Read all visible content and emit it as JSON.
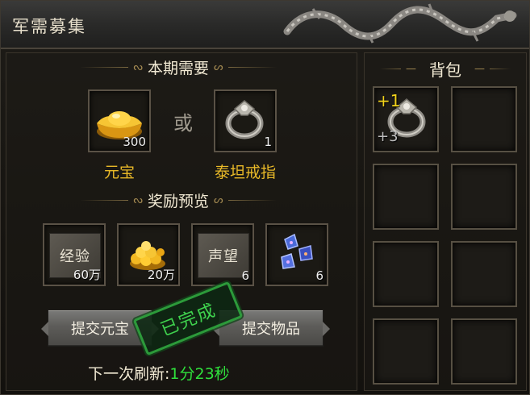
{
  "window": {
    "title": "军需募集"
  },
  "requirement": {
    "header": "本期需要",
    "or_label": "或",
    "items": [
      {
        "name": "元宝",
        "count": "300",
        "icon": "gold-ingot-icon"
      },
      {
        "name": "泰坦戒指",
        "count": "1",
        "icon": "ring-icon"
      }
    ]
  },
  "rewards": {
    "header": "奖励预览",
    "items": [
      {
        "label": "经验",
        "count": "60万",
        "icon": "exp-icon"
      },
      {
        "count": "20万",
        "icon": "gold-coins-icon"
      },
      {
        "label": "声望",
        "count": "6",
        "icon": "prestige-icon"
      },
      {
        "count": "6",
        "icon": "blue-gem-icon"
      }
    ]
  },
  "buttons": {
    "submit_gold": "提交元宝",
    "submit_item": "提交物品"
  },
  "stamp": {
    "text": "已完成",
    "color": "#3fd24e"
  },
  "refresh": {
    "label": "下一次刷新:",
    "time": "1分23秒"
  },
  "bag": {
    "header": "背包",
    "items": [
      {
        "plus": "+1",
        "sub": "+3",
        "icon": "ring-icon"
      }
    ]
  },
  "colors": {
    "item_name": "#e9b928",
    "timer": "#2fe03c"
  }
}
